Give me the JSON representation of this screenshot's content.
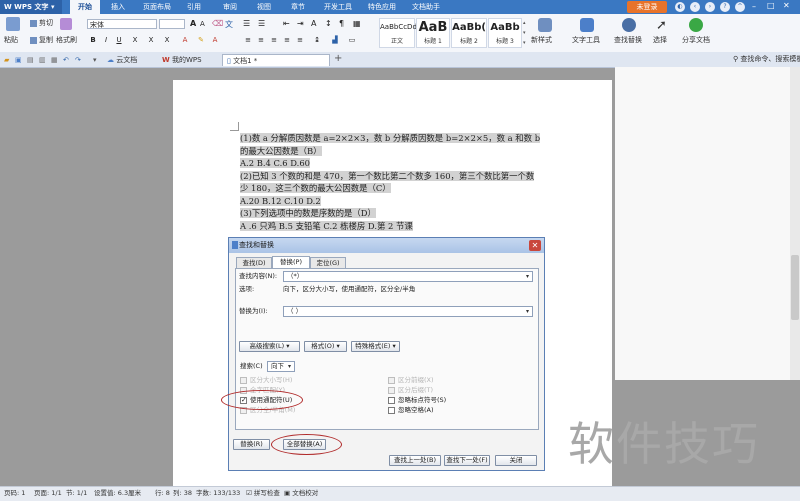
{
  "app": {
    "name": "WPS 文字"
  },
  "menu_tabs": [
    "开始",
    "插入",
    "页面布局",
    "引用",
    "审阅",
    "视图",
    "章节",
    "开发工具",
    "特色应用",
    "文档助手"
  ],
  "titlebar": {
    "login": "未登录"
  },
  "ribbon": {
    "paste": "粘贴",
    "cut": "剪切",
    "copy": "复制",
    "format_painter": "格式刷",
    "font_name": "宋体",
    "new_style": "新样式",
    "text_tools": "文字工具",
    "find_replace": "查找替换",
    "select": "选择",
    "share_doc": "分享文档",
    "styles": [
      {
        "preview": "AaBbCcDd",
        "label": "正文"
      },
      {
        "preview": "AaB",
        "label": "标题 1"
      },
      {
        "preview": "AaBb(",
        "label": "标题 2"
      },
      {
        "preview": "AaBb",
        "label": "标题 3"
      }
    ]
  },
  "doc_tabs": {
    "cloud": "云文档",
    "my_wps": "我的WPS",
    "doc1": "文档1 *"
  },
  "right_panel": {
    "search_hint": "查找命令、搜索模板"
  },
  "document": {
    "lines": [
      "(1)数 a 分解质因数是 a=2×2×3，数 b 分解质因数是 b=2×2×5，数 a 和数 b",
      "的最大公因数是（B）",
      "A.2  B.4  C.6  D.60",
      "(2)已知 3 个数的和是 470，第一个数比第二个数多 160，第三个数比第一个数",
      "少 180，这三个数的最大公因数是（C）",
      "A.20  B.12  C.10  D.2",
      "(3)下列选项中的数是序数的是（D）",
      "A .6 只鸡    B.5 支铅笔    C.2 栋楼房    D.第 2 节课"
    ]
  },
  "dialog": {
    "title": "查找和替换",
    "tabs": [
      "查找(D)",
      "替换(P)",
      "定位(G)"
    ],
    "find_label": "查找内容(N):",
    "find_value": "（*）",
    "options_label": "选项:",
    "options_value": "向下，区分大小写，使用通配符，区分全/半角",
    "replace_label": "替换为(I):",
    "replace_value": "（  ）",
    "advanced_search": "高级搜索(L) ▾",
    "format": "格式(O) ▾",
    "special_format": "特殊格式(E) ▾",
    "search_label": "搜索(C)",
    "search_direction": "向下",
    "checkboxes_left": [
      {
        "label": "区分大小写(H)",
        "checked": false,
        "disabled": true
      },
      {
        "label": "全字匹配(Y)",
        "checked": false,
        "disabled": true
      },
      {
        "label": "使用通配符(U)",
        "checked": true,
        "disabled": false
      },
      {
        "label": "区分全/半角(M)",
        "checked": false,
        "disabled": true
      }
    ],
    "checkboxes_right": [
      {
        "label": "区分前缀(X)",
        "checked": false,
        "disabled": true
      },
      {
        "label": "区分后缀(T)",
        "checked": false,
        "disabled": true
      },
      {
        "label": "忽略标点符号(S)",
        "checked": false,
        "disabled": false
      },
      {
        "label": "忽略空格(A)",
        "checked": false,
        "disabled": false
      }
    ],
    "replace_btn": "替换(R)",
    "replace_all_btn": "全部替换(A)",
    "find_prev_btn": "查找上一处(B)",
    "find_next_btn": "查找下一处(F)",
    "close_btn": "关闭"
  },
  "status": {
    "page_num": "页码: 1",
    "page": "页面: 1/1",
    "section": "节: 1/1",
    "setting": "设置值: 6.3厘米",
    "row": "行: 8",
    "col": "列: 38",
    "words": "字数: 133/133",
    "spell": "拼写检查",
    "proof": "文档校对"
  },
  "watermark": "软件技巧",
  "colors": {
    "accent": "#3a78c2",
    "highlight": "#d2d2d2",
    "annotation": "#b02a2a"
  }
}
